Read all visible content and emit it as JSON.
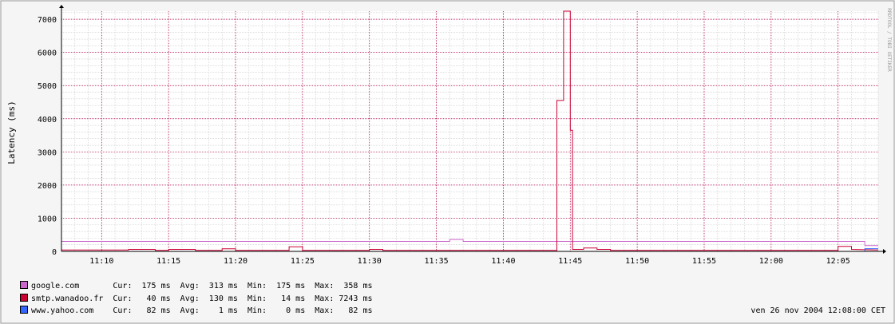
{
  "chart_data": {
    "type": "line",
    "ylabel": "Latency (ms)",
    "watermark": "RRDTOOL / TOBI OETIKER",
    "ylim": [
      0,
      7243
    ],
    "y_ticks": [
      0,
      1000,
      2000,
      3000,
      4000,
      5000,
      6000,
      7000
    ],
    "x_range": [
      "11:07:00",
      "12:08:00"
    ],
    "x_ticks": [
      "11:10",
      "11:15",
      "11:20",
      "11:25",
      "11:30",
      "11:35",
      "11:40",
      "11:45",
      "11:50",
      "11:55",
      "12:00",
      "12:05"
    ],
    "grid": true,
    "legend_placement": "bottom-left",
    "series": [
      {
        "name": "google.com",
        "color": "#cc66cc",
        "stats": {
          "cur": "175 ms",
          "avg": "313 ms",
          "min": "175 ms",
          "max": "358 ms"
        },
        "points": [
          [
            "11:07:00",
            300
          ],
          [
            "11:36:00",
            300
          ],
          [
            "11:36:00",
            358
          ],
          [
            "11:37:00",
            358
          ],
          [
            "11:37:00",
            300
          ],
          [
            "12:07:00",
            300
          ],
          [
            "12:07:00",
            175
          ],
          [
            "12:08:00",
            175
          ]
        ]
      },
      {
        "name": "smtp.wanadoo.fr",
        "color": "#cc0033",
        "stats": {
          "cur": "40 ms",
          "avg": "130 ms",
          "min": "14 ms",
          "max": "7243 ms"
        },
        "points": [
          [
            "11:07:00",
            40
          ],
          [
            "11:12:00",
            40
          ],
          [
            "11:12:00",
            60
          ],
          [
            "11:14:00",
            60
          ],
          [
            "11:14:00",
            30
          ],
          [
            "11:15:00",
            30
          ],
          [
            "11:15:00",
            60
          ],
          [
            "11:17:00",
            60
          ],
          [
            "11:17:00",
            30
          ],
          [
            "11:19:00",
            30
          ],
          [
            "11:19:00",
            80
          ],
          [
            "11:20:00",
            80
          ],
          [
            "11:20:00",
            30
          ],
          [
            "11:24:00",
            30
          ],
          [
            "11:24:00",
            140
          ],
          [
            "11:25:00",
            140
          ],
          [
            "11:25:00",
            30
          ],
          [
            "11:30:00",
            30
          ],
          [
            "11:30:00",
            60
          ],
          [
            "11:31:00",
            60
          ],
          [
            "11:31:00",
            30
          ],
          [
            "11:44:00",
            30
          ],
          [
            "11:44:00",
            4550
          ],
          [
            "11:44:30",
            4550
          ],
          [
            "11:44:30",
            7243
          ],
          [
            "11:45:00",
            7243
          ],
          [
            "11:45:00",
            3650
          ],
          [
            "11:45:10",
            3650
          ],
          [
            "11:45:10",
            60
          ],
          [
            "11:46:00",
            60
          ],
          [
            "11:46:00",
            100
          ],
          [
            "11:47:00",
            100
          ],
          [
            "11:47:00",
            60
          ],
          [
            "11:48:00",
            60
          ],
          [
            "11:48:00",
            30
          ],
          [
            "12:05:00",
            30
          ],
          [
            "12:05:00",
            150
          ],
          [
            "12:06:00",
            150
          ],
          [
            "12:06:00",
            60
          ],
          [
            "12:08:00",
            40
          ]
        ]
      },
      {
        "name": "www.yahoo.com",
        "color": "#3366ff",
        "stats": {
          "cur": "82 ms",
          "avg": "1 ms",
          "min": "0 ms",
          "max": "82 ms"
        },
        "points": [
          [
            "11:07:00",
            0
          ],
          [
            "12:07:00",
            0
          ],
          [
            "12:07:00",
            82
          ],
          [
            "12:08:00",
            82
          ]
        ]
      }
    ]
  },
  "legend_labels": {
    "cur": "Cur:",
    "avg": "Avg:",
    "min": "Min:",
    "max": "Max:"
  },
  "footer": {
    "date": "ven 26 nov 2004 12:08:00 CET"
  }
}
